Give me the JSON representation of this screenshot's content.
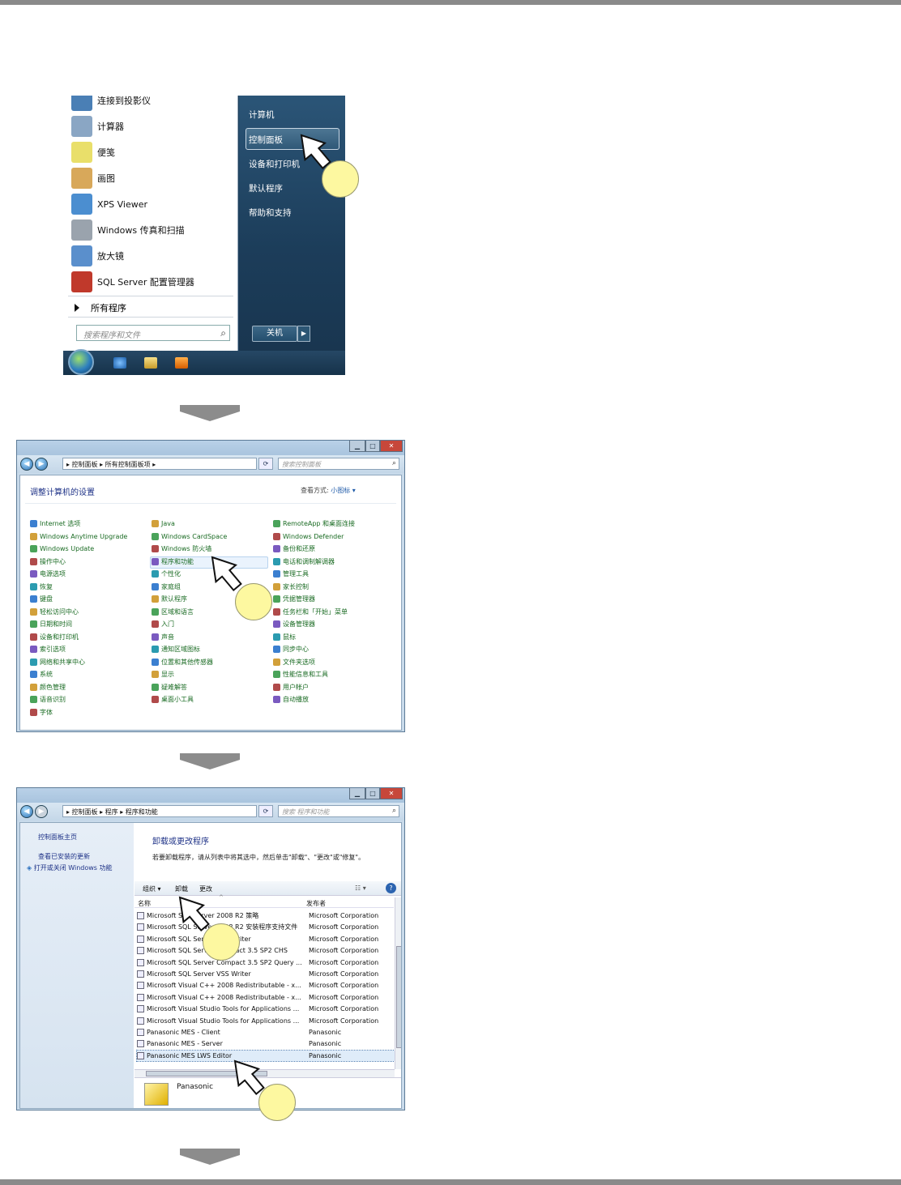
{
  "start_menu": {
    "left_items": [
      {
        "label": "连接到投影仪",
        "icon": "projector-icon",
        "color": "#4a7fb5"
      },
      {
        "label": "计算器",
        "icon": "calculator-icon",
        "color": "#8aa6c4"
      },
      {
        "label": "便笺",
        "icon": "sticky-notes-icon",
        "color": "#e9df6a"
      },
      {
        "label": "画图",
        "icon": "paint-icon",
        "color": "#d8a85a"
      },
      {
        "label": "XPS Viewer",
        "icon": "xps-viewer-icon",
        "color": "#4b8ed0"
      },
      {
        "label": "Windows 传真和扫描",
        "icon": "fax-scan-icon",
        "color": "#9aa3ad"
      },
      {
        "label": "放大镜",
        "icon": "magnifier-icon",
        "color": "#5a8fcc"
      },
      {
        "label": "SQL Server 配置管理器",
        "icon": "sql-config-icon",
        "color": "#c0392b"
      }
    ],
    "all_programs": "所有程序",
    "search_placeholder": "搜索程序和文件",
    "right_items": [
      "计算机",
      "控制面板",
      "设备和打印机",
      "默认程序",
      "帮助和支持"
    ],
    "shutdown": "关机"
  },
  "control_panel": {
    "breadcrumb": "▸ 控制面板 ▸ 所有控制面板项 ▸",
    "search_placeholder": "搜索控制面板",
    "title": "调整计算机的设置",
    "view_by_label": "查看方式:",
    "view_by_value": "小图标 ▾",
    "columns": [
      [
        "Internet 选项",
        "Windows Anytime Upgrade",
        "Windows Update",
        "操作中心",
        "电源选项",
        "恢复",
        "键盘",
        "轻松访问中心",
        "日期和时间",
        "设备和打印机",
        "索引选项",
        "网络和共享中心",
        "系统",
        "颜色管理",
        "语音识别",
        "字体"
      ],
      [
        "Java",
        "Windows CardSpace",
        "Windows 防火墙",
        "程序和功能",
        "个性化",
        "家庭组",
        "默认程序",
        "区域和语言",
        "入门",
        "声音",
        "通知区域图标",
        "位置和其他传感器",
        "显示",
        "疑难解答",
        "桌面小工具"
      ],
      [
        "RemoteApp 和桌面连接",
        "Windows Defender",
        "备份和还原",
        "电话和调制解调器",
        "管理工具",
        "家长控制",
        "凭据管理器",
        "任务栏和「开始」菜单",
        "设备管理器",
        "鼠标",
        "同步中心",
        "文件夹选项",
        "性能信息和工具",
        "用户帐户",
        "自动播放"
      ]
    ]
  },
  "programs": {
    "breadcrumb": "▸ 控制面板 ▸ 程序 ▸ 程序和功能",
    "search_placeholder": "搜索 程序和功能",
    "left_links": [
      "控制面板主页",
      "查看已安装的更新",
      "打开或关闭 Windows 功能"
    ],
    "heading": "卸载或更改程序",
    "description": "若要卸载程序，请从列表中将其选中，然后单击\"卸载\"、\"更改\"或\"修复\"。",
    "toolbar": {
      "organize": "组织 ▾",
      "uninstall": "卸载",
      "change": "更改"
    },
    "col_name": "名称",
    "col_publisher": "发布者",
    "rows": [
      {
        "name": "Microsoft SQL Server 2008 R2 策略",
        "publisher": "Microsoft Corporation"
      },
      {
        "name": "Microsoft SQL Server 2008 R2 安装程序支持文件",
        "publisher": "Microsoft Corporation"
      },
      {
        "name": "Microsoft SQL Server VSS Writer",
        "publisher": "Microsoft Corporation"
      },
      {
        "name": "Microsoft SQL Server Compact 3.5 SP2 CHS",
        "publisher": "Microsoft Corporation"
      },
      {
        "name": "Microsoft SQL Server Compact 3.5 SP2 Query ...",
        "publisher": "Microsoft Corporation"
      },
      {
        "name": "Microsoft SQL Server VSS Writer",
        "publisher": "Microsoft Corporation"
      },
      {
        "name": "Microsoft Visual C++ 2008 Redistributable - x...",
        "publisher": "Microsoft Corporation"
      },
      {
        "name": "Microsoft Visual C++ 2008 Redistributable - x...",
        "publisher": "Microsoft Corporation"
      },
      {
        "name": "Microsoft Visual Studio Tools for Applications ...",
        "publisher": "Microsoft Corporation"
      },
      {
        "name": "Microsoft Visual Studio Tools for Applications ...",
        "publisher": "Microsoft Corporation"
      },
      {
        "name": "Panasonic MES - Client",
        "publisher": "Panasonic"
      },
      {
        "name": "Panasonic MES - Server",
        "publisher": "Panasonic"
      },
      {
        "name": "Panasonic MES LWS Editor",
        "publisher": "Panasonic"
      }
    ],
    "details_publisher": "Panasonic"
  }
}
